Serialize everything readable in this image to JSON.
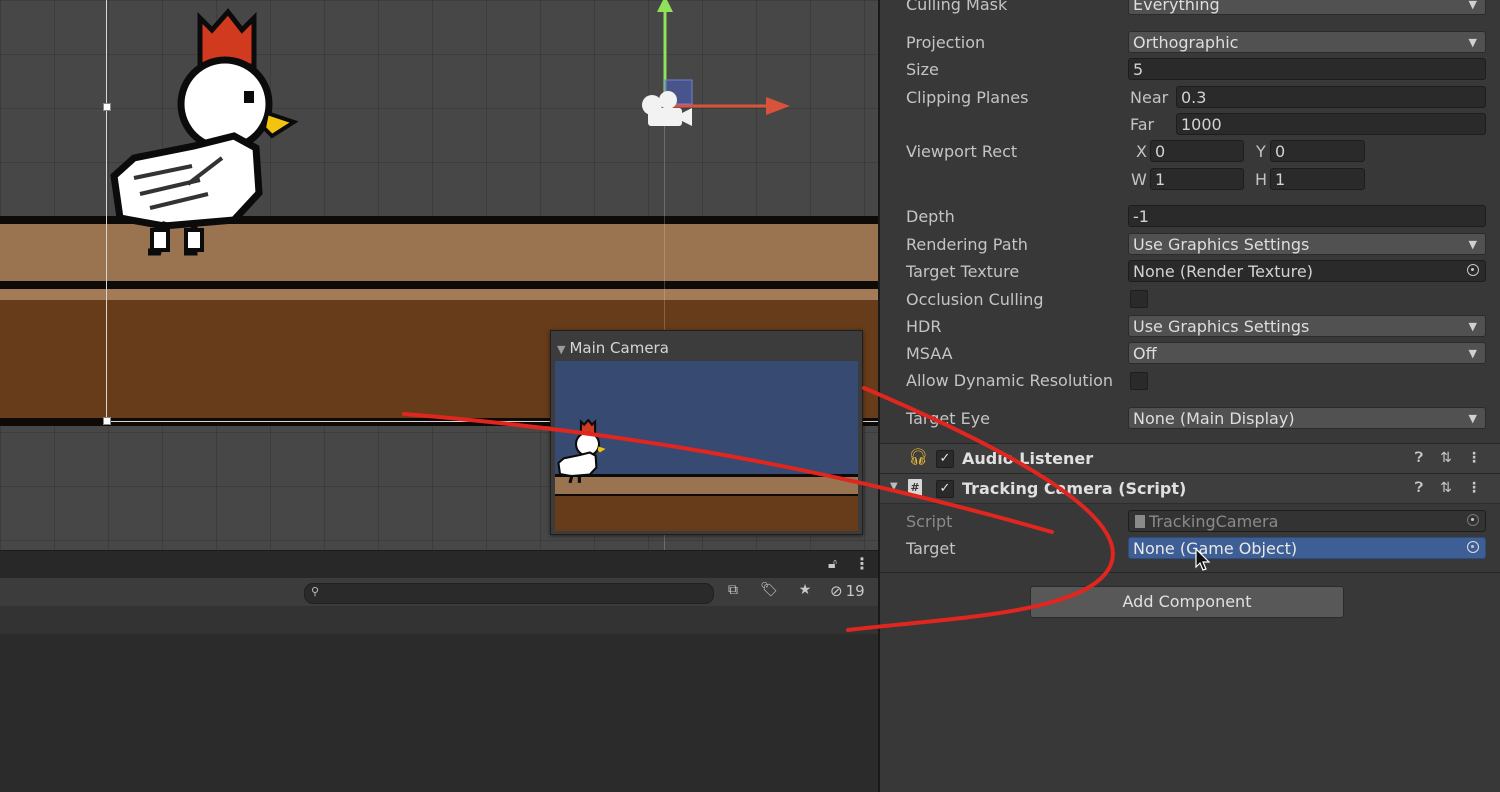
{
  "preview": {
    "title": "Main Camera"
  },
  "project_panel": {
    "hidden_count": "19",
    "search_placeholder": ""
  },
  "inspector": {
    "camera": {
      "culling_mask": {
        "label": "Culling Mask",
        "value": "Everything"
      },
      "projection": {
        "label": "Projection",
        "value": "Orthographic"
      },
      "size": {
        "label": "Size",
        "value": "5"
      },
      "clipping_planes": {
        "label": "Clipping Planes",
        "near_label": "Near",
        "near": "0.3",
        "far_label": "Far",
        "far": "1000"
      },
      "viewport_rect": {
        "label": "Viewport Rect",
        "x_label": "X",
        "x": "0",
        "y_label": "Y",
        "y": "0",
        "w_label": "W",
        "w": "1",
        "h_label": "H",
        "h": "1"
      },
      "depth": {
        "label": "Depth",
        "value": "-1"
      },
      "rendering_path": {
        "label": "Rendering Path",
        "value": "Use Graphics Settings"
      },
      "target_texture": {
        "label": "Target Texture",
        "value": "None (Render Texture)"
      },
      "occlusion_culling": {
        "label": "Occlusion Culling",
        "checked": false
      },
      "hdr": {
        "label": "HDR",
        "value": "Use Graphics Settings"
      },
      "msaa": {
        "label": "MSAA",
        "value": "Off"
      },
      "dynamic_resolution": {
        "label": "Allow Dynamic Resolution",
        "checked": false
      },
      "target_eye": {
        "label": "Target Eye",
        "value": "None (Main Display)"
      }
    },
    "audio_listener": {
      "title": "Audio Listener",
      "enabled": true
    },
    "tracking_camera": {
      "title": "Tracking Camera (Script)",
      "enabled": true,
      "script_label": "Script",
      "script_value": "TrackingCamera",
      "target_label": "Target",
      "target_value": "None (Game Object)"
    },
    "add_component": "Add Component"
  },
  "colors": {
    "accent_selection": "#3e5f96",
    "scene_sky": "#364a72",
    "ground_light": "#9a7350",
    "ground_dark": "#663c1a",
    "annotation_red": "#e0261e"
  }
}
